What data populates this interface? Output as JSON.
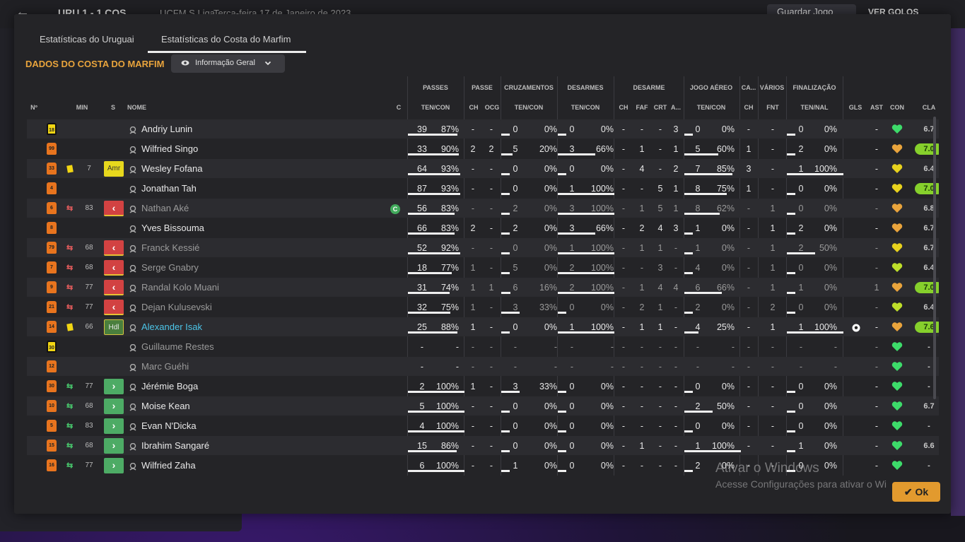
{
  "background": {
    "back_icon": "back-arrow-icon",
    "score": "URU  1 - 1  COS",
    "league": "UCFM S Liga",
    "date": "Terça-feira 17 de Janeiro de 2023",
    "save_label": "Guardar Jogo",
    "goals_label": "VER GOLOS"
  },
  "tabs": [
    {
      "label": "Estatísticas do Uruguai",
      "active": false
    },
    {
      "label": "Estatísticas do Costa do Marfim",
      "active": true
    }
  ],
  "section_title": "DADOS DO COSTA DO MARFIM",
  "view_dropdown": {
    "label": "Informação Geral",
    "icon": "eye-icon"
  },
  "group_headers": [
    "PASSES",
    "PASSE",
    "CRUZAMENTOS",
    "DESARMES",
    "DESARME",
    "JOGO AÉREO",
    "CA...",
    "VÁRIOS",
    "FINALIZAÇÃO"
  ],
  "columns": [
    "Nº",
    "MIN",
    "S",
    "NOME",
    "C",
    "TEN/CON",
    "CH",
    "OCG",
    "TEN/CON",
    "TEN/CON",
    "CH",
    "FAF",
    "CRT",
    "A...",
    "TEN/CON",
    "CH",
    "FNT",
    "TEN/NAL",
    "GLS",
    "AST",
    "CON",
    "CLA"
  ],
  "colors": {
    "accent": "#e9a43c",
    "shirt": "#e8741e",
    "keeper": "#f2d613",
    "rating_high": "#86d02c",
    "sub_off": "#d24242",
    "sub_on": "#4dab65"
  },
  "players": [
    {
      "num": "18",
      "gk": true,
      "card": false,
      "subdir": "",
      "min": "",
      "status": "",
      "name": "Andriy Lunin",
      "cap": false,
      "dim": false,
      "hl": false,
      "pass": [
        "39",
        "87%"
      ],
      "pass_fill": 87,
      "ch": "-",
      "ocg": "-",
      "cross": [
        "0",
        "0%"
      ],
      "cross_fill": 0,
      "tack": [
        "0",
        "0%"
      ],
      "tack_fill": 0,
      "dch": "-",
      "faf": "-",
      "crt": "-",
      "a": "3",
      "air": [
        "0",
        "0%"
      ],
      "air_fill": 0,
      "ca": "-",
      "fnt": "-",
      "shot": [
        "0",
        "0%"
      ],
      "shot_fill": 0,
      "gls": "",
      "ast": "-",
      "mood": "green",
      "cla": "6.7",
      "hi": false
    },
    {
      "num": "99",
      "gk": false,
      "card": false,
      "subdir": "",
      "min": "",
      "status": "",
      "name": "Wilfried Singo",
      "cap": false,
      "dim": false,
      "hl": false,
      "pass": [
        "33",
        "90%"
      ],
      "pass_fill": 90,
      "ch": "2",
      "ocg": "2",
      "cross": [
        "5",
        "20%"
      ],
      "cross_fill": 20,
      "tack": [
        "3",
        "66%"
      ],
      "tack_fill": 66,
      "dch": "-",
      "faf": "1",
      "crt": "-",
      "a": "1",
      "air": [
        "5",
        "60%"
      ],
      "air_fill": 60,
      "ca": "1",
      "fnt": "-",
      "shot": [
        "2",
        "0%"
      ],
      "shot_fill": 0,
      "gls": "",
      "ast": "-",
      "mood": "orange",
      "cla": "7.0",
      "hi": true
    },
    {
      "num": "33",
      "gk": false,
      "card": true,
      "subdir": "",
      "min": "7",
      "status": "Amr",
      "name": "Wesley Fofana",
      "cap": false,
      "dim": false,
      "hl": false,
      "pass": [
        "64",
        "93%"
      ],
      "pass_fill": 93,
      "ch": "-",
      "ocg": "-",
      "cross": [
        "0",
        "0%"
      ],
      "cross_fill": 0,
      "tack": [
        "0",
        "0%"
      ],
      "tack_fill": 0,
      "dch": "-",
      "faf": "4",
      "crt": "-",
      "a": "2",
      "air": [
        "7",
        "85%"
      ],
      "air_fill": 85,
      "ca": "3",
      "fnt": "-",
      "shot": [
        "1",
        "100%"
      ],
      "shot_fill": 100,
      "gls": "",
      "ast": "-",
      "mood": "yellow",
      "cla": "6.4",
      "hi": false
    },
    {
      "num": "4",
      "gk": false,
      "card": false,
      "subdir": "",
      "min": "",
      "status": "",
      "name": "Jonathan Tah",
      "cap": false,
      "dim": false,
      "hl": false,
      "pass": [
        "87",
        "93%"
      ],
      "pass_fill": 93,
      "ch": "-",
      "ocg": "-",
      "cross": [
        "0",
        "0%"
      ],
      "cross_fill": 0,
      "tack": [
        "1",
        "100%"
      ],
      "tack_fill": 100,
      "dch": "-",
      "faf": "-",
      "crt": "5",
      "a": "1",
      "air": [
        "8",
        "75%"
      ],
      "air_fill": 75,
      "ca": "1",
      "fnt": "-",
      "shot": [
        "0",
        "0%"
      ],
      "shot_fill": 0,
      "gls": "",
      "ast": "-",
      "mood": "yellow",
      "cla": "7.0",
      "hi": true
    },
    {
      "num": "6",
      "gk": false,
      "card": false,
      "subdir": "off",
      "min": "83",
      "status": "off",
      "name": "Nathan Aké",
      "cap": true,
      "dim": true,
      "hl": false,
      "pass": [
        "56",
        "83%"
      ],
      "pass_fill": 83,
      "ch": "-",
      "ocg": "-",
      "cross": [
        "2",
        "0%"
      ],
      "cross_fill": 0,
      "tack": [
        "3",
        "100%"
      ],
      "tack_fill": 100,
      "dch": "-",
      "faf": "1",
      "crt": "5",
      "a": "1",
      "air": [
        "8",
        "62%"
      ],
      "air_fill": 62,
      "ca": "-",
      "fnt": "1",
      "shot": [
        "0",
        "0%"
      ],
      "shot_fill": 0,
      "gls": "",
      "ast": "-",
      "mood": "orange",
      "cla": "6.8",
      "hi": false
    },
    {
      "num": "8",
      "gk": false,
      "card": false,
      "subdir": "",
      "min": "",
      "status": "",
      "name": "Yves Bissouma",
      "cap": false,
      "dim": false,
      "hl": false,
      "pass": [
        "66",
        "83%"
      ],
      "pass_fill": 83,
      "ch": "2",
      "ocg": "-",
      "cross": [
        "2",
        "0%"
      ],
      "cross_fill": 0,
      "tack": [
        "3",
        "66%"
      ],
      "tack_fill": 66,
      "dch": "-",
      "faf": "2",
      "crt": "4",
      "a": "3",
      "air": [
        "1",
        "0%"
      ],
      "air_fill": 0,
      "ca": "-",
      "fnt": "1",
      "shot": [
        "2",
        "0%"
      ],
      "shot_fill": 0,
      "gls": "",
      "ast": "-",
      "mood": "orange",
      "cla": "6.7",
      "hi": false
    },
    {
      "num": "79",
      "gk": false,
      "card": false,
      "subdir": "off",
      "min": "68",
      "status": "off",
      "name": "Franck Kessié",
      "cap": false,
      "dim": true,
      "hl": false,
      "pass": [
        "52",
        "92%"
      ],
      "pass_fill": 92,
      "ch": "-",
      "ocg": "-",
      "cross": [
        "0",
        "0%"
      ],
      "cross_fill": 0,
      "tack": [
        "1",
        "100%"
      ],
      "tack_fill": 100,
      "dch": "-",
      "faf": "1",
      "crt": "1",
      "a": "-",
      "air": [
        "1",
        "0%"
      ],
      "air_fill": 0,
      "ca": "-",
      "fnt": "1",
      "shot": [
        "2",
        "50%"
      ],
      "shot_fill": 50,
      "gls": "",
      "ast": "-",
      "mood": "yellow",
      "cla": "6.7",
      "hi": false
    },
    {
      "num": "7",
      "gk": false,
      "card": false,
      "subdir": "off",
      "min": "68",
      "status": "off",
      "name": "Serge Gnabry",
      "cap": false,
      "dim": true,
      "hl": false,
      "pass": [
        "18",
        "77%"
      ],
      "pass_fill": 77,
      "ch": "1",
      "ocg": "-",
      "cross": [
        "5",
        "0%"
      ],
      "cross_fill": 0,
      "tack": [
        "2",
        "100%"
      ],
      "tack_fill": 100,
      "dch": "-",
      "faf": "-",
      "crt": "3",
      "a": "-",
      "air": [
        "4",
        "0%"
      ],
      "air_fill": 0,
      "ca": "-",
      "fnt": "1",
      "shot": [
        "0",
        "0%"
      ],
      "shot_fill": 0,
      "gls": "",
      "ast": "-",
      "mood": "lime",
      "cla": "6.4",
      "hi": false
    },
    {
      "num": "9",
      "gk": false,
      "card": false,
      "subdir": "off",
      "min": "77",
      "status": "off",
      "name": "Randal Kolo Muani",
      "cap": false,
      "dim": true,
      "hl": false,
      "pass": [
        "31",
        "74%"
      ],
      "pass_fill": 74,
      "ch": "1",
      "ocg": "1",
      "cross": [
        "6",
        "16%"
      ],
      "cross_fill": 16,
      "tack": [
        "2",
        "100%"
      ],
      "tack_fill": 100,
      "dch": "-",
      "faf": "1",
      "crt": "4",
      "a": "4",
      "air": [
        "6",
        "66%"
      ],
      "air_fill": 66,
      "ca": "-",
      "fnt": "1",
      "shot": [
        "1",
        "0%"
      ],
      "shot_fill": 0,
      "gls": "",
      "ast": "1",
      "mood": "orange",
      "cla": "7.0",
      "hi": true
    },
    {
      "num": "21",
      "gk": false,
      "card": false,
      "subdir": "off",
      "min": "77",
      "status": "off",
      "name": "Dejan Kulusevski",
      "cap": false,
      "dim": true,
      "hl": false,
      "pass": [
        "32",
        "75%"
      ],
      "pass_fill": 75,
      "ch": "1",
      "ocg": "-",
      "cross": [
        "3",
        "33%"
      ],
      "cross_fill": 33,
      "tack": [
        "0",
        "0%"
      ],
      "tack_fill": 0,
      "dch": "-",
      "faf": "2",
      "crt": "1",
      "a": "-",
      "air": [
        "2",
        "0%"
      ],
      "air_fill": 0,
      "ca": "-",
      "fnt": "2",
      "shot": [
        "0",
        "0%"
      ],
      "shot_fill": 0,
      "gls": "",
      "ast": "-",
      "mood": "lime",
      "cla": "6.4",
      "hi": false
    },
    {
      "num": "14",
      "gk": false,
      "card": true,
      "subdir": "",
      "min": "66",
      "status": "Hdl",
      "name": "Alexander Isak",
      "cap": false,
      "dim": false,
      "hl": true,
      "pass": [
        "25",
        "88%"
      ],
      "pass_fill": 88,
      "ch": "1",
      "ocg": "-",
      "cross": [
        "0",
        "0%"
      ],
      "cross_fill": 0,
      "tack": [
        "1",
        "100%"
      ],
      "tack_fill": 100,
      "dch": "-",
      "faf": "1",
      "crt": "1",
      "a": "-",
      "air": [
        "4",
        "25%"
      ],
      "air_fill": 25,
      "ca": "-",
      "fnt": "1",
      "shot": [
        "1",
        "100%"
      ],
      "shot_fill": 100,
      "gls": "ball",
      "ast": "-",
      "mood": "orange",
      "cla": "7.6",
      "hi": true
    },
    {
      "num": "30",
      "gk": true,
      "card": false,
      "subdir": "",
      "min": "",
      "status": "",
      "name": "Guillaume Restes",
      "cap": false,
      "dim": true,
      "hl": false,
      "pass": [
        "-",
        "-"
      ],
      "pass_fill": -1,
      "ch": "-",
      "ocg": "-",
      "cross": [
        "-",
        "-"
      ],
      "cross_fill": -1,
      "tack": [
        "-",
        "-"
      ],
      "tack_fill": -1,
      "dch": "-",
      "faf": "-",
      "crt": "-",
      "a": "-",
      "air": [
        "-",
        "-"
      ],
      "air_fill": -1,
      "ca": "-",
      "fnt": "-",
      "shot": [
        "-",
        "-"
      ],
      "shot_fill": -1,
      "gls": "",
      "ast": "-",
      "mood": "green",
      "cla": "-",
      "hi": false
    },
    {
      "num": "12",
      "gk": false,
      "card": false,
      "subdir": "",
      "min": "",
      "status": "",
      "name": "Marc Guéhi",
      "cap": false,
      "dim": true,
      "hl": false,
      "pass": [
        "-",
        "-"
      ],
      "pass_fill": -1,
      "ch": "-",
      "ocg": "-",
      "cross": [
        "-",
        "-"
      ],
      "cross_fill": -1,
      "tack": [
        "-",
        "-"
      ],
      "tack_fill": -1,
      "dch": "-",
      "faf": "-",
      "crt": "-",
      "a": "-",
      "air": [
        "-",
        "-"
      ],
      "air_fill": -1,
      "ca": "-",
      "fnt": "-",
      "shot": [
        "-",
        "-"
      ],
      "shot_fill": -1,
      "gls": "",
      "ast": "-",
      "mood": "green",
      "cla": "-",
      "hi": false
    },
    {
      "num": "30",
      "gk": false,
      "card": false,
      "subdir": "on",
      "min": "77",
      "status": "on",
      "name": "Jérémie Boga",
      "cap": false,
      "dim": false,
      "hl": false,
      "pass": [
        "2",
        "100%"
      ],
      "pass_fill": 100,
      "ch": "1",
      "ocg": "-",
      "cross": [
        "3",
        "33%"
      ],
      "cross_fill": 33,
      "tack": [
        "0",
        "0%"
      ],
      "tack_fill": 0,
      "dch": "-",
      "faf": "-",
      "crt": "-",
      "a": "-",
      "air": [
        "0",
        "0%"
      ],
      "air_fill": 0,
      "ca": "-",
      "fnt": "-",
      "shot": [
        "0",
        "0%"
      ],
      "shot_fill": 0,
      "gls": "",
      "ast": "-",
      "mood": "green",
      "cla": "-",
      "hi": false
    },
    {
      "num": "10",
      "gk": false,
      "card": false,
      "subdir": "on",
      "min": "68",
      "status": "on",
      "name": "Moise Kean",
      "cap": false,
      "dim": false,
      "hl": false,
      "pass": [
        "5",
        "100%"
      ],
      "pass_fill": 100,
      "ch": "-",
      "ocg": "-",
      "cross": [
        "0",
        "0%"
      ],
      "cross_fill": 0,
      "tack": [
        "0",
        "0%"
      ],
      "tack_fill": 0,
      "dch": "-",
      "faf": "-",
      "crt": "-",
      "a": "-",
      "air": [
        "2",
        "50%"
      ],
      "air_fill": 50,
      "ca": "-",
      "fnt": "-",
      "shot": [
        "0",
        "0%"
      ],
      "shot_fill": 0,
      "gls": "",
      "ast": "-",
      "mood": "green",
      "cla": "6.7",
      "hi": false
    },
    {
      "num": "5",
      "gk": false,
      "card": false,
      "subdir": "on",
      "min": "83",
      "status": "on",
      "name": "Evan N'Dicka",
      "cap": false,
      "dim": false,
      "hl": false,
      "pass": [
        "4",
        "100%"
      ],
      "pass_fill": 100,
      "ch": "-",
      "ocg": "-",
      "cross": [
        "0",
        "0%"
      ],
      "cross_fill": 0,
      "tack": [
        "0",
        "0%"
      ],
      "tack_fill": 0,
      "dch": "-",
      "faf": "-",
      "crt": "-",
      "a": "-",
      "air": [
        "0",
        "0%"
      ],
      "air_fill": 0,
      "ca": "-",
      "fnt": "-",
      "shot": [
        "0",
        "0%"
      ],
      "shot_fill": 0,
      "gls": "",
      "ast": "-",
      "mood": "green",
      "cla": "-",
      "hi": false
    },
    {
      "num": "15",
      "gk": false,
      "card": false,
      "subdir": "on",
      "min": "68",
      "status": "on",
      "name": "Ibrahim Sangaré",
      "cap": false,
      "dim": false,
      "hl": false,
      "pass": [
        "15",
        "86%"
      ],
      "pass_fill": 86,
      "ch": "-",
      "ocg": "-",
      "cross": [
        "0",
        "0%"
      ],
      "cross_fill": 0,
      "tack": [
        "0",
        "0%"
      ],
      "tack_fill": 0,
      "dch": "-",
      "faf": "1",
      "crt": "-",
      "a": "-",
      "air": [
        "1",
        "100%"
      ],
      "air_fill": 100,
      "ca": "-",
      "fnt": "-",
      "shot": [
        "1",
        "0%"
      ],
      "shot_fill": 0,
      "gls": "",
      "ast": "-",
      "mood": "green",
      "cla": "6.6",
      "hi": false
    },
    {
      "num": "16",
      "gk": false,
      "card": false,
      "subdir": "on",
      "min": "77",
      "status": "on",
      "name": "Wilfried Zaha",
      "cap": false,
      "dim": false,
      "hl": false,
      "pass": [
        "6",
        "100%"
      ],
      "pass_fill": 100,
      "ch": "-",
      "ocg": "-",
      "cross": [
        "1",
        "0%"
      ],
      "cross_fill": 0,
      "tack": [
        "0",
        "0%"
      ],
      "tack_fill": 0,
      "dch": "-",
      "faf": "-",
      "crt": "-",
      "a": "-",
      "air": [
        "2",
        "0%"
      ],
      "air_fill": 0,
      "ca": "-",
      "fnt": "-",
      "shot": [
        "0",
        "0%"
      ],
      "shot_fill": 0,
      "gls": "",
      "ast": "-",
      "mood": "green",
      "cla": "-",
      "hi": false
    }
  ],
  "watermark": {
    "line1": "Ativar o Windows",
    "line2": "Acesse Configurações para ativar o Wi"
  },
  "ok_label": "Ok"
}
